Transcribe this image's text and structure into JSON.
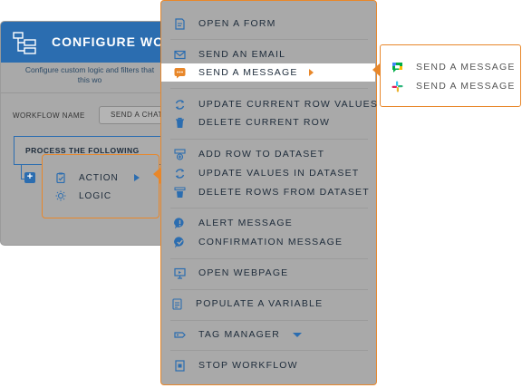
{
  "workflow_panel": {
    "title": "CONFIGURE WO",
    "description_line1": "Configure custom logic and filters that",
    "description_line2": "this wo",
    "workflow_name_label": "WORKFLOW NAME",
    "workflow_name_value": "SEND A CHAT",
    "process_label": "PROCESS THE FOLLOWING",
    "add_icon": "plus-icon",
    "header_icon": "workflow-diagram-icon"
  },
  "action_popup": {
    "items": [
      {
        "label": "ACTION",
        "icon": "clipboard-check-icon"
      },
      {
        "label": "LOGIC",
        "icon": "lightbulb-icon"
      }
    ]
  },
  "menu": {
    "items": [
      {
        "label": "OPEN A FORM",
        "icon": "form-icon"
      },
      {
        "label": "SEND AN EMAIL",
        "icon": "email-icon"
      },
      {
        "label": "SEND A MESSAGE",
        "icon": "chat-bubble-icon"
      },
      {
        "label": "UPDATE CURRENT ROW VALUES",
        "icon": "refresh-row-icon"
      },
      {
        "label": "DELETE CURRENT ROW",
        "icon": "trash-icon"
      },
      {
        "label": "ADD ROW TO DATASET",
        "icon": "add-row-icon"
      },
      {
        "label": "UPDATE VALUES IN DATASET",
        "icon": "refresh-dataset-icon"
      },
      {
        "label": "DELETE ROWS FROM DATASET",
        "icon": "trash-dataset-icon"
      },
      {
        "label": "ALERT MESSAGE",
        "icon": "alert-icon"
      },
      {
        "label": "CONFIRMATION MESSAGE",
        "icon": "check-circle-icon"
      },
      {
        "label": "OPEN WEBPAGE",
        "icon": "monitor-icon"
      },
      {
        "label": "POPULATE A VARIABLE",
        "icon": "variable-icon"
      },
      {
        "label": "TAG MANAGER",
        "icon": "tag-icon"
      },
      {
        "label": "STOP WORKFLOW",
        "icon": "stop-icon"
      }
    ]
  },
  "submenu": {
    "items": [
      {
        "label": "SEND A MESSAGE",
        "icon": "google-chat-icon"
      },
      {
        "label": "SEND A MESSAGE",
        "icon": "slack-icon"
      }
    ]
  },
  "colors": {
    "accent_orange": "#e8872a",
    "brand_blue": "#2b6db0",
    "overlay_gray": "#a9a9a9"
  }
}
